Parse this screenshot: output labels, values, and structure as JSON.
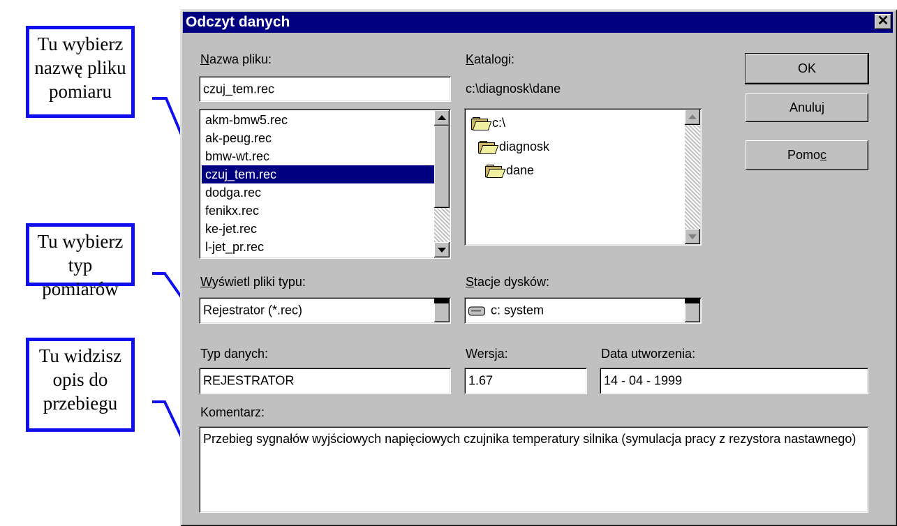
{
  "callouts": [
    {
      "lines": [
        "Tu wybierz",
        "nazwę pliku",
        "pomiaru"
      ]
    },
    {
      "lines": [
        "Tu wybierz",
        "typ pomiarów"
      ]
    },
    {
      "lines": [
        "Tu widzisz",
        "opis do",
        "przebiegu"
      ]
    }
  ],
  "dialog": {
    "title": "Odczyt danych",
    "close_glyph": "✕",
    "file_name": {
      "label_u": "N",
      "label_rest": "azwa pliku:",
      "value": "czuj_tem.rec"
    },
    "file_list": {
      "items": [
        "akm-bmw5.rec",
        "ak-peug.rec",
        "bmw-wt.rec",
        "czuj_tem.rec",
        "dodga.rec",
        "fenikx.rec",
        "ke-jet.rec",
        "l-jet_pr.rec"
      ],
      "selected_index": 3
    },
    "directories": {
      "label_u": "K",
      "label_rest": "atalogi:",
      "current_path": "c:\\diagnosk\\dane",
      "tree": [
        "c:\\",
        "diagnosk",
        "dane"
      ]
    },
    "buttons": {
      "ok": "OK",
      "cancel": "Anuluj",
      "help_pre": "Pomo",
      "help_u": "c"
    },
    "file_type": {
      "label_u": "W",
      "label_rest": "yświetl pliki typu:",
      "value": "Rejestrator (*.rec)"
    },
    "drives": {
      "label_u": "S",
      "label_rest": "tacje dysków:",
      "value": "c: system"
    },
    "data_type": {
      "label": "Typ danych:",
      "value": "REJESTRATOR"
    },
    "version": {
      "label": "Wersja:",
      "value": "1.67"
    },
    "created": {
      "label": "Data utworzenia:",
      "value": "14 - 04 - 1999"
    },
    "comment": {
      "label": "Komentarz:",
      "value": "Przebieg sygnałów wyjściowych napięciowych czujnika temperatury silnika (symulacja pracy z rezystora nastawnego)"
    }
  }
}
